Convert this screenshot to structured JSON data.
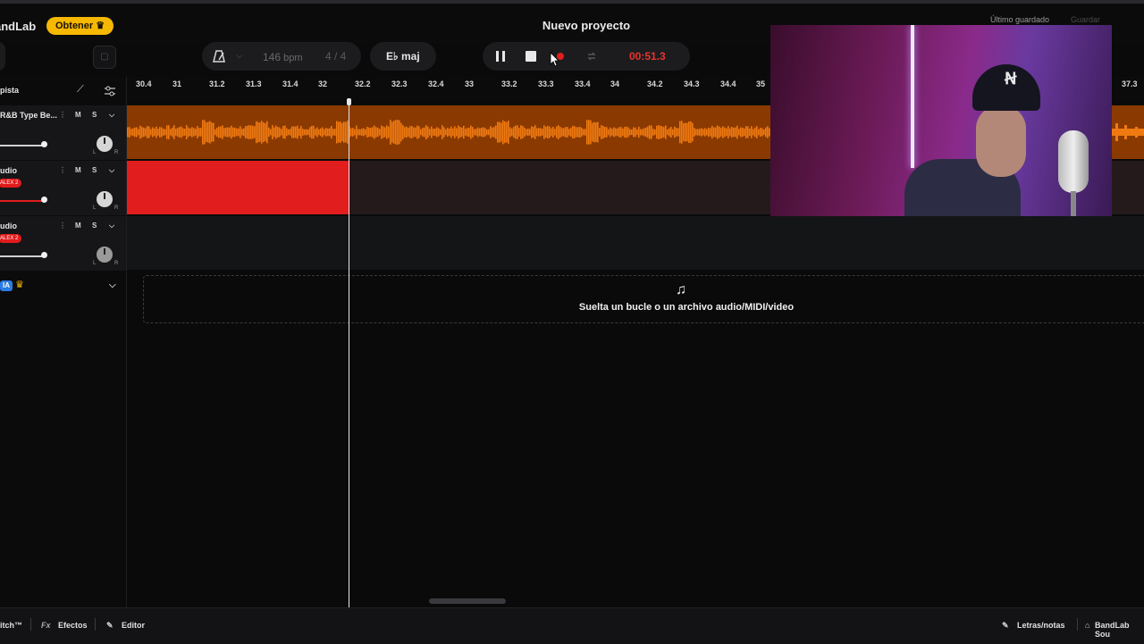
{
  "app": {
    "logo": "andLab",
    "get_button": "Obtener ♛",
    "project_title": "Nuevo proyecto",
    "last_saved": "Último guardado",
    "save_label": "Guardar"
  },
  "transport": {
    "bpm_value": "146",
    "bpm_unit": "bpm",
    "time_signature": "4 / 4",
    "key": "E♭ maj",
    "time_display": "00:51.3"
  },
  "sidebar": {
    "add_track_label": "pista",
    "tracks": [
      {
        "name": "R&B Type Be...",
        "mute": "M",
        "solo": "S",
        "tag": "",
        "volume": 0.8
      },
      {
        "name": "udio",
        "mute": "M",
        "solo": "S",
        "tag": "ALEX 2",
        "volume": 0.8
      },
      {
        "name": "udio",
        "mute": "M",
        "solo": "S",
        "tag": "ALEX 2",
        "volume": 0.8
      }
    ],
    "ai_badge": "IA",
    "knob_left": "L",
    "knob_right": "R"
  },
  "ruler": {
    "ticks": [
      "30.4",
      "31",
      "31.2",
      "31.3",
      "31.4",
      "32",
      "32.2",
      "32.3",
      "32.4",
      "33",
      "33.2",
      "33.3",
      "33.4",
      "34",
      "34.2",
      "34.3",
      "34.4",
      "35",
      "37.3"
    ]
  },
  "dropzone": {
    "text": "Suelta un bucle o un archivo audio/MIDI/video"
  },
  "bottom_bar": {
    "autopitch": "itch™",
    "fx_prefix": "Fx",
    "effects": "Efectos",
    "editor": "Editor",
    "lyrics": "Letras/notas",
    "sounds": "BandLab Sou"
  },
  "colors": {
    "accent_orange": "#f07a12",
    "record_red": "#e11d1d",
    "get_button": "#f6b800"
  }
}
